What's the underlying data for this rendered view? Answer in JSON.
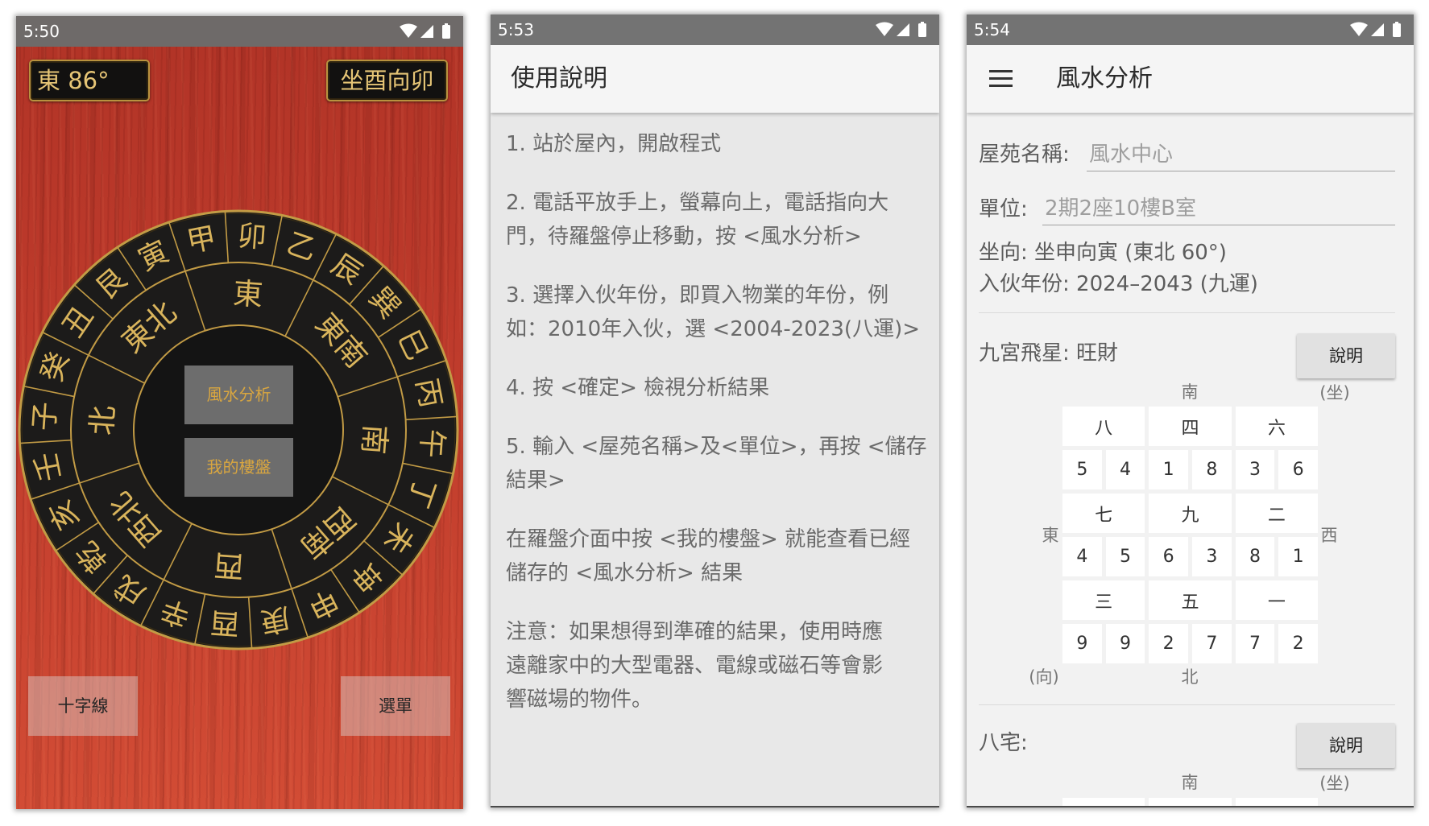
{
  "phone1": {
    "status_time": "5:50",
    "heading_label": "東 86°",
    "heading_deg": 86,
    "sitting_facing": "坐酉向卯",
    "compass": {
      "mountains": [
        "子",
        "癸",
        "丑",
        "艮",
        "寅",
        "甲",
        "卯",
        "乙",
        "辰",
        "巽",
        "巳",
        "丙",
        "午",
        "丁",
        "未",
        "坤",
        "申",
        "庚",
        "酉",
        "辛",
        "戌",
        "乾",
        "亥",
        "壬"
      ],
      "directions": [
        "北",
        "東北",
        "東",
        "東南",
        "南",
        "西南",
        "西",
        "西北"
      ]
    },
    "buttons": {
      "analysis": "風水分析",
      "my_property": "我的樓盤",
      "crosshair": "十字線",
      "menu": "選單"
    }
  },
  "phone2": {
    "status_time": "5:53",
    "title": "使用說明",
    "paragraphs": [
      {
        "lines": [
          "1. 站於屋內，開啟程式"
        ]
      },
      {
        "lines": [
          "2. 電話平放手上，螢幕向上，電話指向大",
          "門，待羅盤停止移動，按 <風水分析>"
        ]
      },
      {
        "lines": [
          "3. 選擇入伙年份，即買入物業的年份，例",
          "如：2010年入伙，選 <2004-2023(八運)>"
        ]
      },
      {
        "lines": [
          "4. 按 <確定> 檢視分析結果"
        ]
      },
      {
        "lines": [
          "5. 輸入 <屋苑名稱>及<單位>，再按 <儲存",
          "結果>"
        ]
      },
      {
        "lines": [
          "在羅盤介面中按 <我的樓盤> 就能查看已經",
          "儲存的 <風水分析> 結果"
        ]
      },
      {
        "lines": [
          "注意：如果想得到準確的結果，使用時應",
          "遠離家中的大型電器、電線或磁石等會影",
          "響磁場的物件。"
        ]
      }
    ]
  },
  "phone3": {
    "status_time": "5:54",
    "title": "風水分析",
    "menu_icon": "hamburger-menu-icon",
    "form": {
      "estate_label": "屋苑名稱:",
      "estate_placeholder": "風水中心",
      "unit_label": "單位:",
      "unit_placeholder": "2期2座10樓B室"
    },
    "orientation": "坐向: 坐申向寅 (東北 60°)",
    "move_in_year": "入伙年份: 2024–2043 (九運)",
    "flying_stars": {
      "title": "九宮飛星: 旺財",
      "help_button": "說明",
      "labels": {
        "top": "南",
        "top_right": "(坐)",
        "left": "東",
        "right": "西",
        "bottom_left": "(向)",
        "bottom": "北"
      },
      "palaces": [
        {
          "name": "八",
          "stars": [
            "5",
            "4"
          ]
        },
        {
          "name": "四",
          "stars": [
            "1",
            "8"
          ]
        },
        {
          "name": "六",
          "stars": [
            "3",
            "6"
          ]
        },
        {
          "name": "七",
          "stars": [
            "4",
            "5"
          ]
        },
        {
          "name": "九",
          "stars": [
            "6",
            "3"
          ]
        },
        {
          "name": "二",
          "stars": [
            "8",
            "1"
          ]
        },
        {
          "name": "三",
          "stars": [
            "9",
            "9"
          ]
        },
        {
          "name": "五",
          "stars": [
            "2",
            "7"
          ]
        },
        {
          "name": "一",
          "stars": [
            "7",
            "2"
          ]
        }
      ]
    },
    "eight_mansions": {
      "title": "八宅:",
      "help_button": "說明",
      "labels": {
        "top": "南",
        "top_right": "(坐)"
      }
    }
  },
  "status_icons": [
    "wifi-icon",
    "signal-icon",
    "battery-icon"
  ],
  "colors": {
    "gold_text": "#d9b45c",
    "gold_line": "#c29b45",
    "ring_black": "#1c1b1a",
    "inner_black": "#141414",
    "wood_red": "#c23d2c",
    "status_gray": "#737373"
  }
}
